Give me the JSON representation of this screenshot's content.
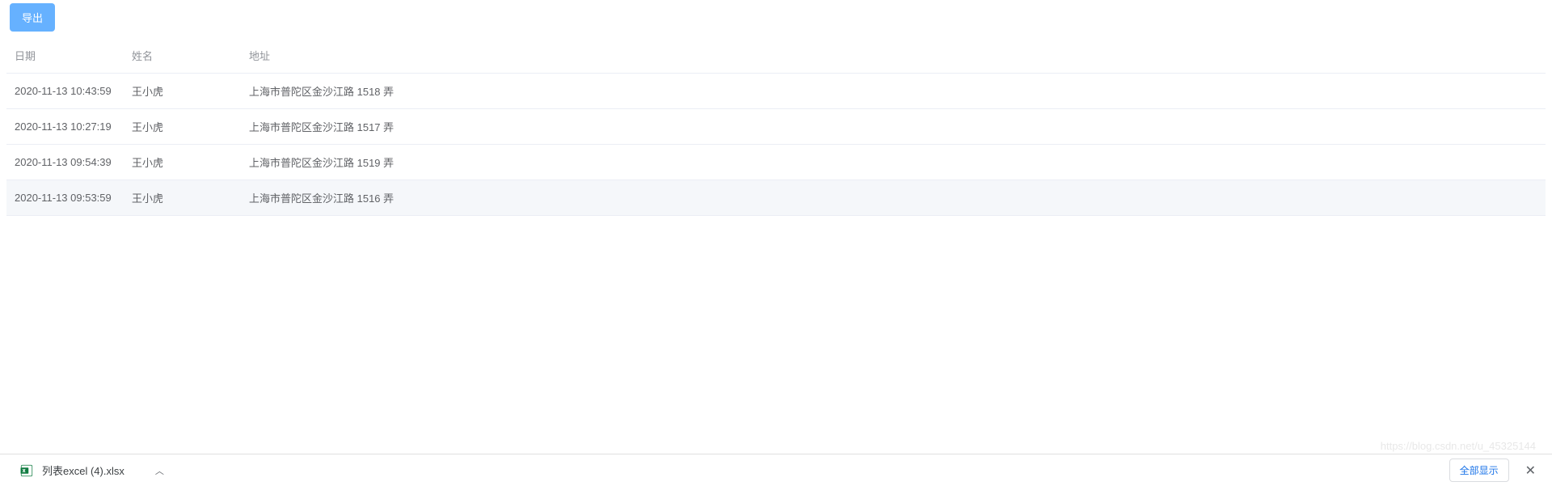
{
  "toolbar": {
    "export_label": "导出"
  },
  "table": {
    "headers": {
      "date": "日期",
      "name": "姓名",
      "address": "地址"
    },
    "rows": [
      {
        "date": "2020-11-13 10:43:59",
        "name": "王小虎",
        "address": "上海市普陀区金沙江路 1518 弄"
      },
      {
        "date": "2020-11-13 10:27:19",
        "name": "王小虎",
        "address": "上海市普陀区金沙江路 1517 弄"
      },
      {
        "date": "2020-11-13 09:54:39",
        "name": "王小虎",
        "address": "上海市普陀区金沙江路 1519 弄"
      },
      {
        "date": "2020-11-13 09:53:59",
        "name": "王小虎",
        "address": "上海市普陀区金沙江路 1516 弄"
      }
    ]
  },
  "download_bar": {
    "filename": "列表excel (4).xlsx",
    "show_all_label": "全部显示"
  },
  "watermark": "https://blog.csdn.net/u_45325144"
}
